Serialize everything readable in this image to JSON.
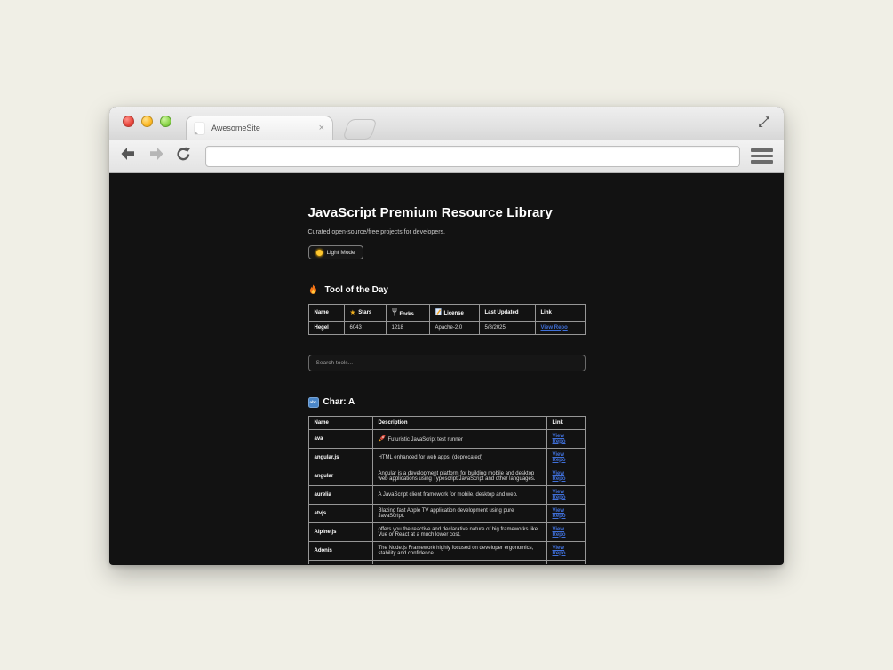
{
  "colors": {
    "accent_link": "#3f6fd8",
    "star": "#f2b01e",
    "page_bg": "#121212",
    "desktop_bg": "#f0efe6"
  },
  "browser": {
    "tab_title": "AwesomeSite",
    "tab_close_glyph": "×",
    "address_value": ""
  },
  "page": {
    "title": "JavaScript Premium Resource Library",
    "subtitle": "Curated open-source/free projects for developers.",
    "light_mode_button": "Light Mode",
    "search_placeholder": "Search tools...",
    "tool_of_day": {
      "heading": "Tool of the Day",
      "headers": {
        "name": "Name",
        "stars": "Stars",
        "forks": "Forks",
        "license": "License",
        "last_updated": "Last Updated",
        "link": "Link"
      },
      "row": {
        "name": "Hegel",
        "stars": "6043",
        "forks": "1218",
        "license": "Apache-2.0",
        "last_updated": "5/8/2025",
        "link_label": "View Repo"
      }
    },
    "char_a": {
      "heading": "Char: A",
      "icon_label": "abc",
      "headers": {
        "name": "Name",
        "description": "Description",
        "link": "Link"
      },
      "rows": [
        {
          "name": "ava",
          "description": "Futuristic JavaScript test runner",
          "link_label": "View Repo"
        },
        {
          "name": "angular.js",
          "description": "HTML enhanced for web apps. (deprecated)",
          "link_label": "View Repo"
        },
        {
          "name": "angular",
          "description": "Angular is a development platform for building mobile and desktop web applications using Typescript/JavaScript and other languages.",
          "link_label": "View Repo"
        },
        {
          "name": "aurelia",
          "description": "A JavaScript client framework for mobile, desktop and web.",
          "link_label": "View Repo"
        },
        {
          "name": "atvjs",
          "description": "Blazing fast Apple TV application development using pure JavaScript.",
          "link_label": "View Repo"
        },
        {
          "name": "Alpine.js",
          "description": "offers you the reactive and declarative nature of big frameworks like Vue or React at a much lower cost.",
          "link_label": "View Repo"
        },
        {
          "name": "Adonis",
          "description": "The Node.js Framework highly focused on developer ergonomics, stability and confidence.",
          "link_label": "View Repo"
        }
      ]
    }
  }
}
